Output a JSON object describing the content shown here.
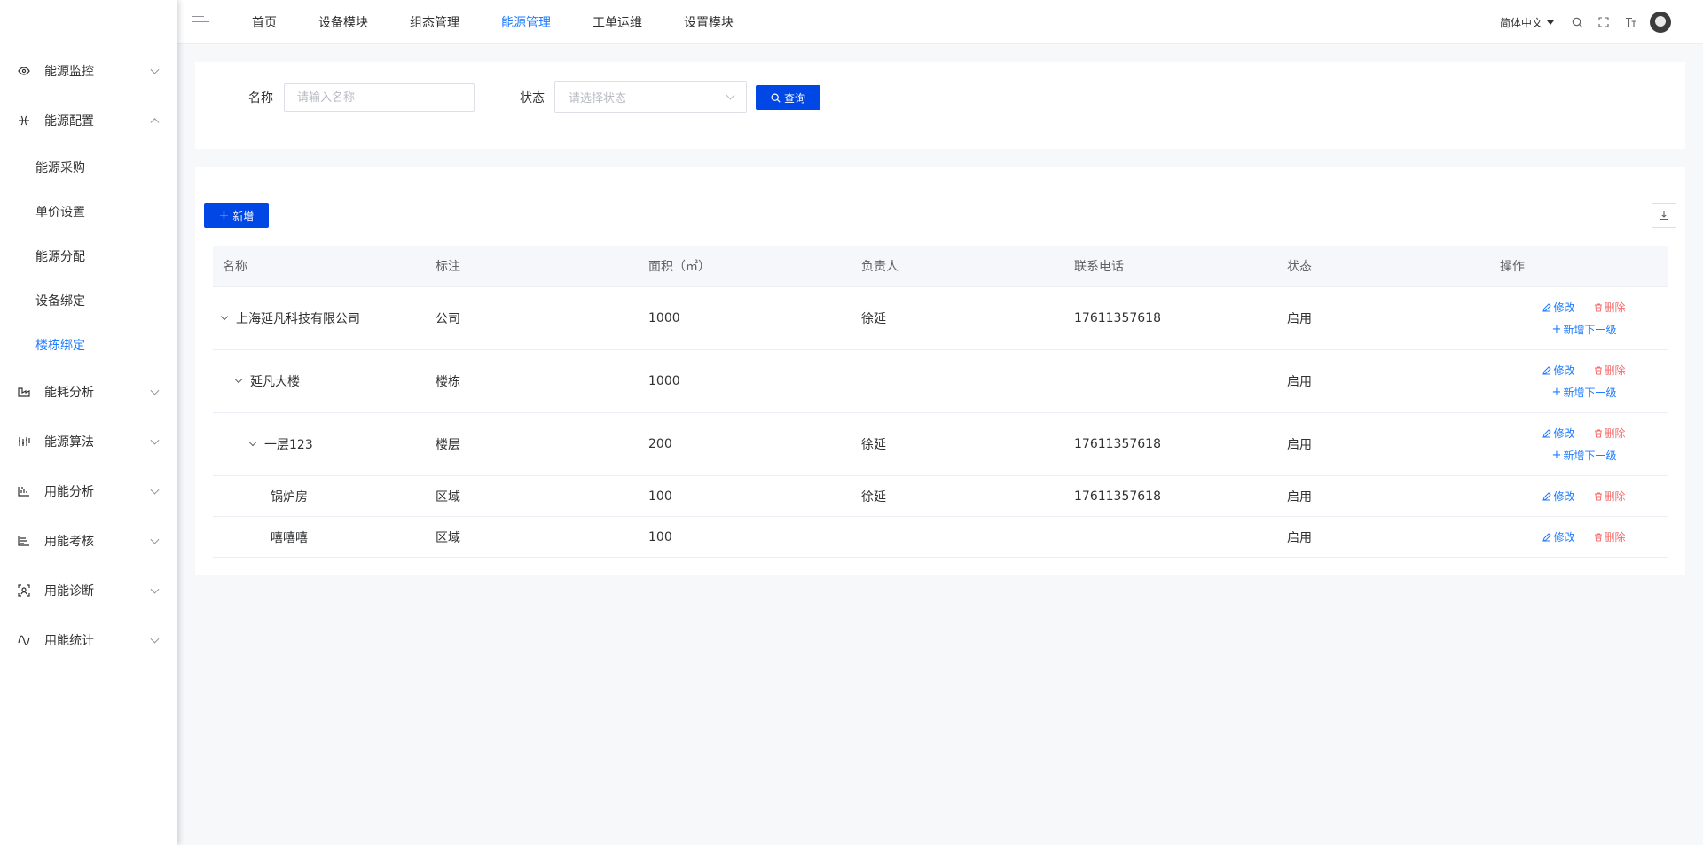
{
  "sidebar": {
    "groups": [
      {
        "label": "能源监控",
        "icon": "eye-icon",
        "expanded": false
      },
      {
        "label": "能源配置",
        "icon": "config-icon",
        "expanded": true,
        "children": [
          "能源采购",
          "单价设置",
          "能源分配",
          "设备绑定",
          "楼栋绑定"
        ]
      },
      {
        "label": "能耗分析",
        "icon": "factory-icon",
        "expanded": false
      },
      {
        "label": "能源算法",
        "icon": "algorithm-icon",
        "expanded": false
      },
      {
        "label": "用能分析",
        "icon": "analysis-icon",
        "expanded": false
      },
      {
        "label": "用能考核",
        "icon": "assessment-icon",
        "expanded": false
      },
      {
        "label": "用能诊断",
        "icon": "diagnosis-icon",
        "expanded": false
      },
      {
        "label": "用能统计",
        "icon": "wave-icon",
        "expanded": false
      }
    ],
    "active_child": "楼栋绑定"
  },
  "topnav": {
    "items": [
      "首页",
      "设备模块",
      "组态管理",
      "能源管理",
      "工单运维",
      "设置模块"
    ],
    "active": "能源管理",
    "language": "简体中文"
  },
  "search": {
    "name_label": "名称",
    "name_placeholder": "请输入名称",
    "status_label": "状态",
    "status_placeholder": "请选择状态",
    "query_button": "查询"
  },
  "toolbar": {
    "add_button": "新增"
  },
  "table": {
    "headers": [
      "名称",
      "标注",
      "面积（㎡）",
      "负责人",
      "联系电话",
      "状态",
      "操作"
    ],
    "rows": [
      {
        "name": "上海延凡科技有限公司",
        "level": 0,
        "expandable": true,
        "tag": "公司",
        "area": "1000",
        "owner": "徐延",
        "phone": "17611357618",
        "status": "启用",
        "add_sub": true
      },
      {
        "name": "延凡大楼",
        "level": 1,
        "expandable": true,
        "tag": "楼栋",
        "area": "1000",
        "owner": "",
        "phone": "",
        "status": "启用",
        "add_sub": true
      },
      {
        "name": "一层123",
        "level": 2,
        "expandable": true,
        "tag": "楼层",
        "area": "200",
        "owner": "徐延",
        "phone": "17611357618",
        "status": "启用",
        "add_sub": true
      },
      {
        "name": "锅炉房",
        "level": 3,
        "expandable": false,
        "tag": "区域",
        "area": "100",
        "owner": "徐延",
        "phone": "17611357618",
        "status": "启用",
        "add_sub": false
      },
      {
        "name": "嘻嘻嘻",
        "level": 3,
        "expandable": false,
        "tag": "区域",
        "area": "100",
        "owner": "",
        "phone": "",
        "status": "启用",
        "add_sub": false
      }
    ],
    "ops": {
      "edit": "修改",
      "delete": "删除",
      "add_sub": "新增下一级"
    }
  },
  "colors": {
    "primary": "#0047e6",
    "link": "#1e7bff",
    "danger": "#f56c6c"
  }
}
